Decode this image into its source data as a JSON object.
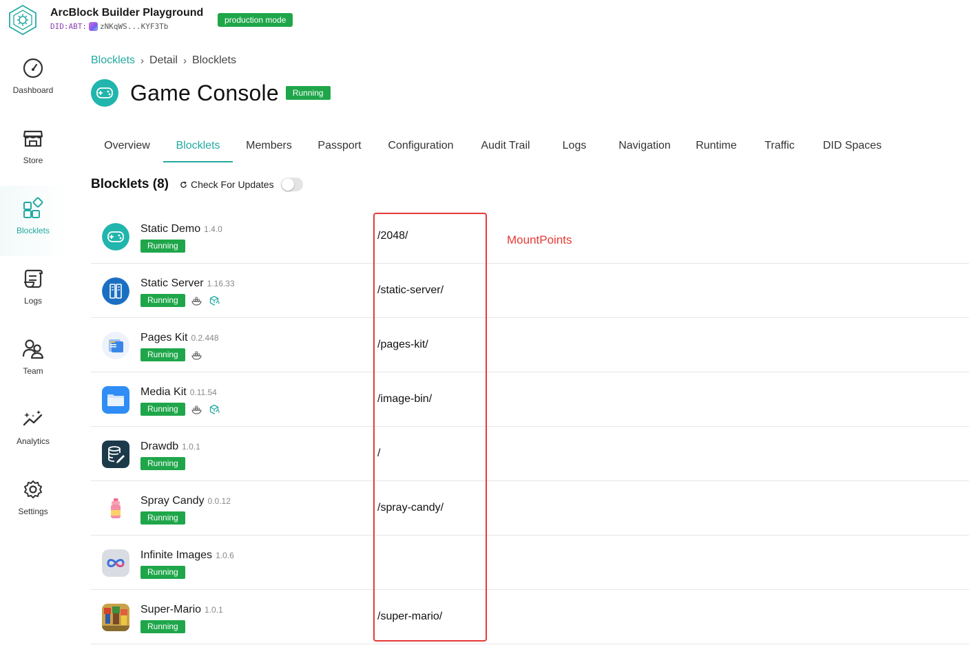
{
  "app": {
    "title": "ArcBlock Builder Playground",
    "did_prefix": "DID:ABT:",
    "did_value": "zNKqWS...KYF3Tb",
    "mode_badge": "production mode"
  },
  "sidebar": {
    "items": [
      {
        "label": "Dashboard",
        "icon": "dashboard-gauge-icon",
        "active": false
      },
      {
        "label": "Store",
        "icon": "store-icon",
        "active": false
      },
      {
        "label": "Blocklets",
        "icon": "blocklets-grid-icon",
        "active": true
      },
      {
        "label": "Logs",
        "icon": "logs-scroll-icon",
        "active": false
      },
      {
        "label": "Team",
        "icon": "team-icon",
        "active": false
      },
      {
        "label": "Analytics",
        "icon": "analytics-icon",
        "active": false
      },
      {
        "label": "Settings",
        "icon": "settings-gear-icon",
        "active": false
      }
    ]
  },
  "breadcrumb": {
    "items": [
      "Blocklets",
      "Detail",
      "Blocklets"
    ],
    "separator": "›"
  },
  "page": {
    "title": "Game Console",
    "status": "Running",
    "icon": "gamepad-icon"
  },
  "tabs": [
    {
      "label": "Overview",
      "active": false
    },
    {
      "label": "Blocklets",
      "active": true
    },
    {
      "label": "Members",
      "active": false
    },
    {
      "label": "Passport",
      "active": false
    },
    {
      "label": "Configuration",
      "active": false
    },
    {
      "label": "Audit Trail",
      "active": false
    },
    {
      "label": "Logs",
      "active": false
    },
    {
      "label": "Navigation",
      "active": false
    },
    {
      "label": "Runtime",
      "active": false
    },
    {
      "label": "Traffic",
      "active": false
    },
    {
      "label": "DID Spaces",
      "active": false
    }
  ],
  "section": {
    "title": "Blocklets (8)",
    "check_updates_label": "Check For Updates",
    "auto_update_enabled": false
  },
  "blocklets": [
    {
      "name": "Static Demo",
      "version": "1.4.0",
      "status": "Running",
      "mount": "/2048/",
      "icon": "gamepad-icon",
      "extra_icons": []
    },
    {
      "name": "Static Server",
      "version": "1.16.33",
      "status": "Running",
      "mount": "/static-server/",
      "icon": "server-icon",
      "extra_icons": [
        "docker-icon",
        "component-sync-icon"
      ]
    },
    {
      "name": "Pages Kit",
      "version": "0.2.448",
      "status": "Running",
      "mount": "/pages-kit/",
      "icon": "pages-kit-icon",
      "extra_icons": [
        "docker-icon"
      ]
    },
    {
      "name": "Media Kit",
      "version": "0.11.54",
      "status": "Running",
      "mount": "/image-bin/",
      "icon": "folder-icon",
      "extra_icons": [
        "docker-icon",
        "component-sync-icon"
      ]
    },
    {
      "name": "Drawdb",
      "version": "1.0.1",
      "status": "Running",
      "mount": "/",
      "icon": "database-pen-icon",
      "extra_icons": []
    },
    {
      "name": "Spray Candy",
      "version": "0.0.12",
      "status": "Running",
      "mount": "/spray-candy/",
      "icon": "spray-can-icon",
      "extra_icons": []
    },
    {
      "name": "Infinite Images",
      "version": "1.0.6",
      "status": "Running",
      "mount": "",
      "icon": "infinity-icon",
      "extra_icons": []
    },
    {
      "name": "Super-Mario",
      "version": "1.0.1",
      "status": "Running",
      "mount": "/super-mario/",
      "icon": "mario-icon",
      "extra_icons": []
    }
  ],
  "annotation": {
    "label": "MountPoints",
    "color": "#e53935"
  },
  "colors": {
    "accent": "#23a9a0",
    "running_green": "#1fa64a"
  }
}
